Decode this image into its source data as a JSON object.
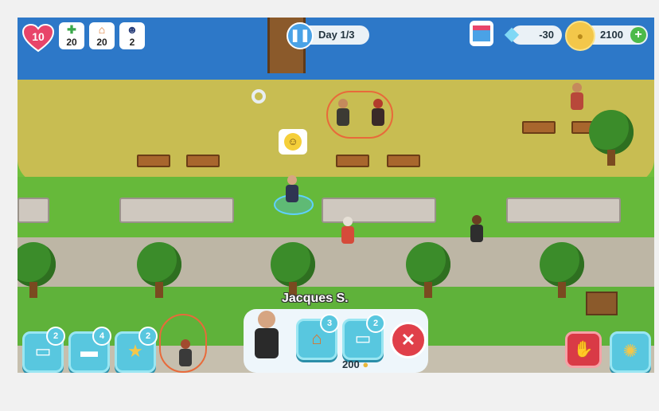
{
  "hud": {
    "hearts": "10",
    "health_count": "20",
    "houses_count": "20",
    "police_count": "2",
    "day_label": "Day 1/3",
    "gems": "-30",
    "coins": "2100",
    "add_symbol": "+"
  },
  "panel": {
    "character_name": "Jacques S.",
    "house_count": "3",
    "mask_count": "2",
    "cost": "200"
  },
  "toolbar": {
    "mask_count": "2",
    "bed_count": "4",
    "badge_count": "2"
  },
  "colors": {
    "water": "#2d78c8",
    "sand": "#c8bd52",
    "grass": "#66b93a",
    "button_cyan": "#58c7df",
    "cancel_red": "#e0404a",
    "heart_pink": "#e8456a"
  },
  "icons": [
    "heart-icon",
    "medical-cross-icon",
    "house-icon",
    "police-icon",
    "pause-icon",
    "shop-icon",
    "diamond-icon",
    "coin-icon",
    "plus-icon",
    "mask-icon",
    "bed-icon",
    "badge-icon",
    "close-icon",
    "stop-hand-icon",
    "virus-icon",
    "smiley-icon"
  ]
}
